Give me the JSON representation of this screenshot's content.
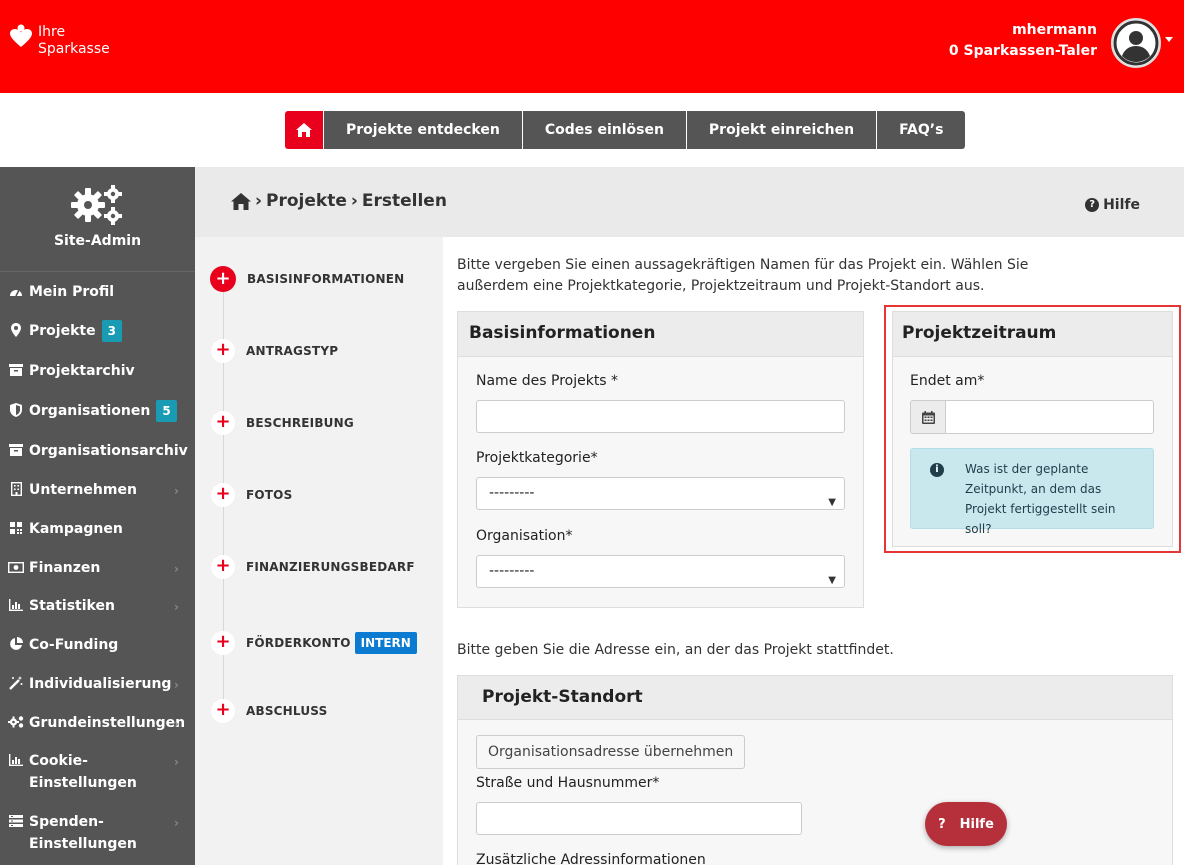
{
  "header": {
    "logo_line1": "Ihre",
    "logo_line2": "Sparkasse",
    "username": "mhermann",
    "taler": "0 Sparkassen-Taler"
  },
  "topnav": {
    "items": [
      "Projekte entdecken",
      "Codes einlösen",
      "Projekt einreichen",
      "FAQ’s"
    ]
  },
  "sidebar": {
    "title": "Site-Admin",
    "items": [
      {
        "label": "Mein Profil",
        "icon": "dashboard-icon"
      },
      {
        "label": "Projekte",
        "icon": "map-marker-icon",
        "badge": "3"
      },
      {
        "label": "Projektarchiv",
        "icon": "archive-icon"
      },
      {
        "label": "Organisationen",
        "icon": "shield-icon",
        "badge": "5"
      },
      {
        "label": "Organisationsarchiv",
        "icon": "archive-icon"
      },
      {
        "label": "Unternehmen",
        "icon": "building-icon"
      },
      {
        "label": "Kampagnen",
        "icon": "grid-icon"
      },
      {
        "label": "Finanzen",
        "icon": "money-icon"
      },
      {
        "label": "Statistiken",
        "icon": "bar-chart-icon"
      },
      {
        "label": "Co-Funding",
        "icon": "pie-chart-icon"
      },
      {
        "label": "Individualisierung",
        "icon": "magic-wand-icon"
      },
      {
        "label": "Grundeinstellungen",
        "icon": "gears-icon"
      },
      {
        "label": "Cookie-Einstellungen",
        "icon": "bar-chart-icon"
      },
      {
        "label": "Spenden-Einstellungen",
        "icon": "list-icon"
      }
    ]
  },
  "breadcrumb": {
    "part1": "Projekte",
    "part2": "Erstellen",
    "help": "Hilfe"
  },
  "steps": [
    {
      "label": "BASISINFORMATIONEN",
      "active": true
    },
    {
      "label": "ANTRAGSTYP"
    },
    {
      "label": "BESCHREIBUNG"
    },
    {
      "label": "FOTOS"
    },
    {
      "label": "FINANZIERUNGSBEDARF"
    },
    {
      "label": "FÖRDERKONTO",
      "badge": "INTERN"
    },
    {
      "label": "ABSCHLUSS"
    }
  ],
  "main": {
    "intro": "Bitte vergeben Sie einen aussagekräftigen Namen für das Projekt ein. Wählen Sie außerdem eine Projektkategorie, Projektzeitraum und Projekt-Standort aus.",
    "basis": {
      "title": "Basisinformationen",
      "name_label": "Name des Projekts *",
      "kategorie_label": "Projektkategorie*",
      "kategorie_value": "---------",
      "organisation_label": "Organisation*",
      "organisation_value": "---------"
    },
    "zeitraum": {
      "title": "Projektzeitraum",
      "ende_label": "Endet am*",
      "info": "Was ist der geplante Zeitpunkt, an dem das Projekt fertiggestellt sein soll?"
    },
    "address_intro": "Bitte geben Sie die Adresse ein, an der das Projekt stattfindet.",
    "standort": {
      "title": "Projekt-Standort",
      "org_button": "Organisationsadresse übernehmen",
      "strasse_label": "Straße und Hausnummer*",
      "zusatz_label": "Zusätzliche Adressinformationen"
    },
    "help_float": "Hilfe"
  }
}
